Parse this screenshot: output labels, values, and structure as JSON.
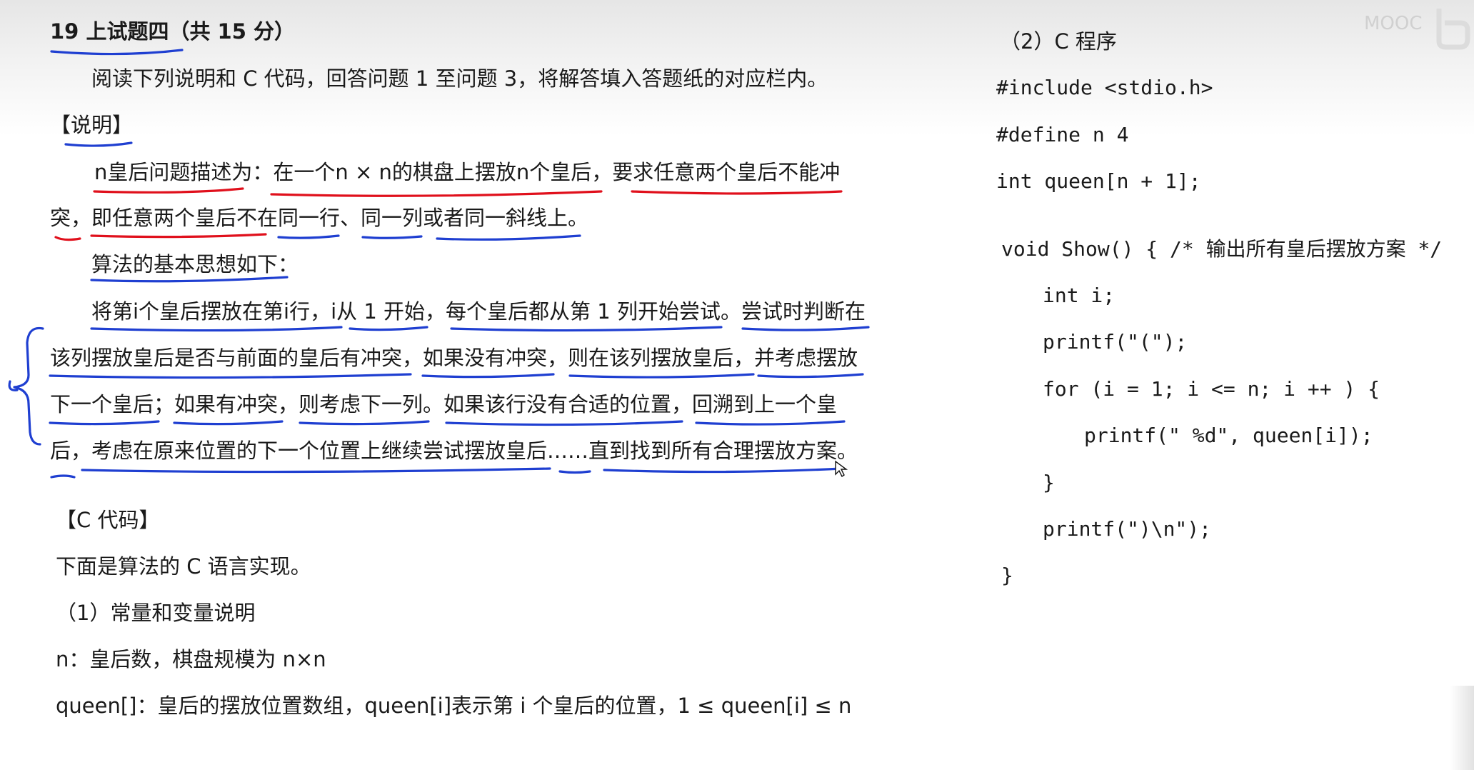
{
  "left": {
    "title": "19 上试题四（共 15 分）",
    "intro": "阅读下列说明和 C 代码，回答问题 1 至问题 3，将解答填入答题纸的对应栏内。",
    "desc_heading": "【说明】",
    "desc_lines": [
      "n皇后问题描述为：在一个n × n的棋盘上摆放n个皇后，要求任意两个皇后不能冲",
      "突，即任意两个皇后不在同一行、同一列或者同一斜线上。",
      "算法的基本思想如下：",
      "将第i个皇后摆放在第i行，i从 1 开始，每个皇后都从第 1 列开始尝试。尝试时判断在",
      "该列摆放皇后是否与前面的皇后有冲突，如果没有冲突，则在该列摆放皇后，并考虑摆放",
      "下一个皇后；如果有冲突，则考虑下一列。如果该行没有合适的位置，回溯到上一个皇",
      "后，考虑在原来位置的下一个位置上继续尝试摆放皇后……直到找到所有合理摆放方案。"
    ],
    "code_heading": "【C 代码】",
    "code_intro": "下面是算法的 C 语言实现。",
    "sub1": "（1）常量和变量说明",
    "var_n": "n：皇后数，棋盘规模为 n×n",
    "var_queen": "queen[]：皇后的摆放位置数组，queen[i]表示第 i 个皇后的位置，1 ≤ queen[i] ≤ n"
  },
  "right": {
    "sub2": "（2）C 程序",
    "code_lines": [
      "#include <stdio.h>",
      "#define n 4",
      "int queen[n + 1];",
      "void Show() { /* 输出所有皇后摆放方案 */",
      "int i;",
      "printf(\"(\");",
      "for (i = 1; i <= n; i ++ ) {",
      "printf(\" %d\", queen[i]);",
      "}",
      "printf(\")\\n\");",
      "}"
    ]
  },
  "watermark": "MOOC",
  "colors": {
    "text": "#1a1a1a",
    "ink_blue": "#1f3fd1",
    "ink_red": "#e0101c"
  }
}
